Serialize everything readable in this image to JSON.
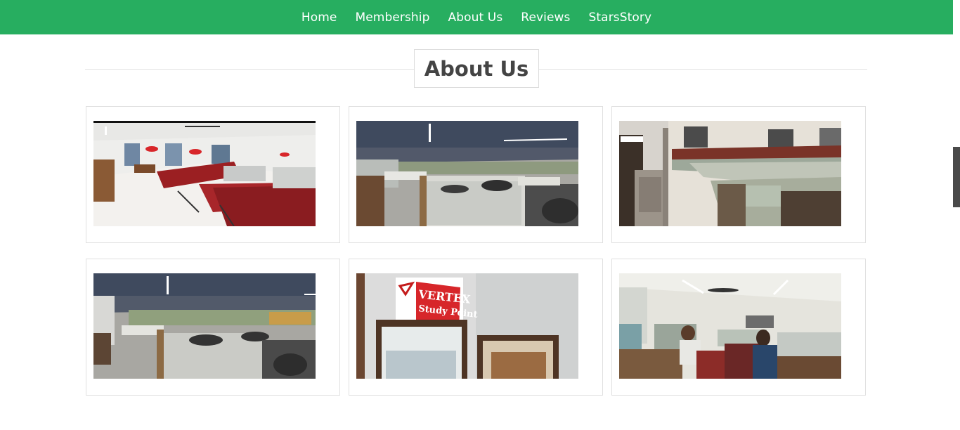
{
  "nav": {
    "items": [
      "Home",
      "Membership",
      "About Us",
      "Reviews",
      "StarsStory"
    ]
  },
  "section": {
    "title": "About Us"
  },
  "gallery": {
    "photos": [
      "study-hall-red-chairs",
      "study-hall-cubicles-dark-ceiling",
      "study-hall-office-room",
      "study-hall-cubicles-students",
      "vertex-study-point-sign",
      "study-hall-students-reading"
    ],
    "sign_text": [
      "VERTEX",
      "Study Point"
    ]
  },
  "colors": {
    "nav_background": "#27ae60",
    "nav_text": "#ffffff",
    "title_text": "#444444"
  }
}
